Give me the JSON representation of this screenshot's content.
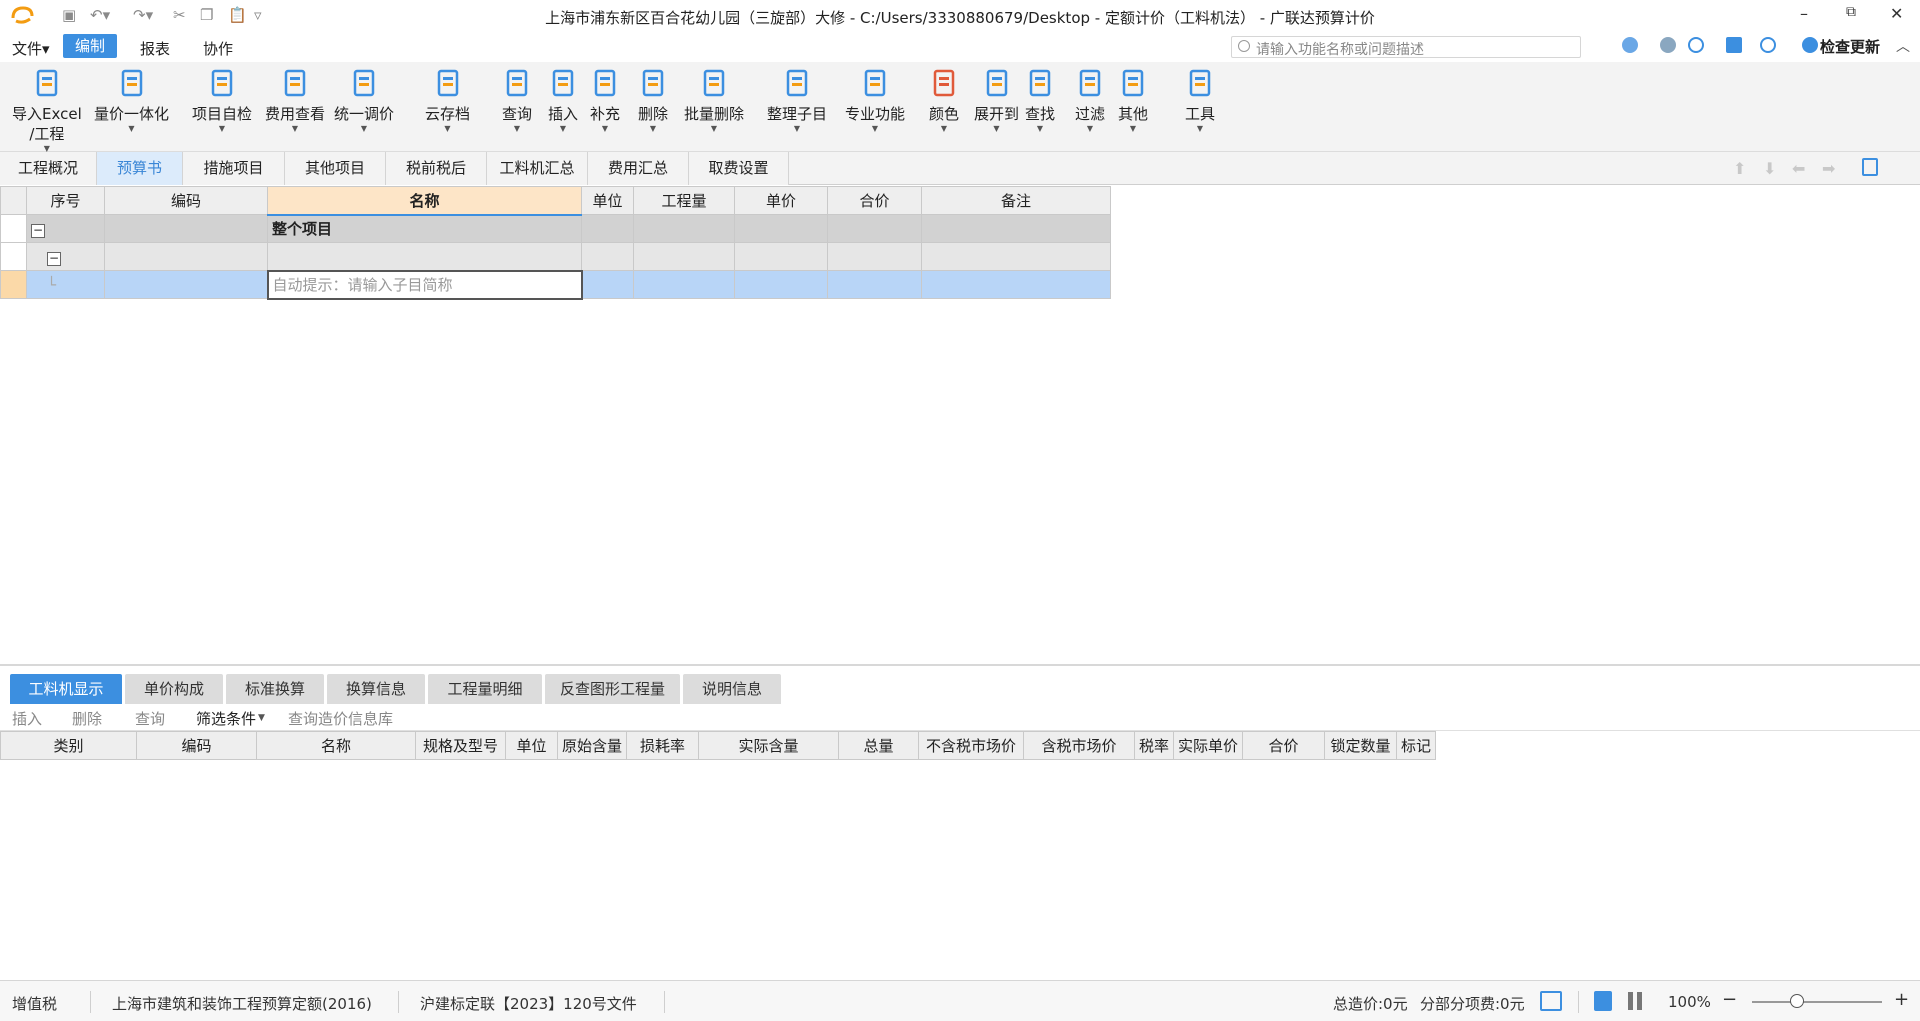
{
  "window": {
    "title": "上海市浦东新区百合花幼儿园（三旋部）大修 - C:/Users/3330880679/Desktop - 定额计价（工料机法） - 广联达预算计价",
    "min": "–",
    "restore": "⧉",
    "close": "✕"
  },
  "menu": {
    "file": "文件▾",
    "edit": "编制",
    "report": "报表",
    "collab": "协作",
    "search_placeholder": "请输入功能名称或问题描述",
    "check_update": "检查更新"
  },
  "ribbon": [
    {
      "l1": "导入Excel",
      "l2": "/工程",
      "icon": "excel-import-icon"
    },
    {
      "l1": "量价一体化",
      "icon": "qty-price-icon"
    },
    {
      "l1": "项目自检",
      "icon": "self-check-icon"
    },
    {
      "l1": "费用查看",
      "icon": "fee-view-icon"
    },
    {
      "l1": "统一调价",
      "icon": "adjust-price-icon"
    },
    {
      "l1": "云存档",
      "icon": "cloud-save-icon"
    },
    {
      "l1": "查询",
      "icon": "query-icon"
    },
    {
      "l1": "插入",
      "icon": "insert-icon"
    },
    {
      "l1": "补充",
      "icon": "supplement-icon"
    },
    {
      "l1": "删除",
      "icon": "delete-icon"
    },
    {
      "l1": "批量删除",
      "icon": "batch-delete-icon"
    },
    {
      "l1": "整理子目",
      "icon": "organize-icon"
    },
    {
      "l1": "专业功能",
      "icon": "pro-function-icon"
    },
    {
      "l1": "颜色",
      "icon": "color-icon"
    },
    {
      "l1": "展开到",
      "icon": "expand-icon"
    },
    {
      "l1": "查找",
      "icon": "find-icon"
    },
    {
      "l1": "过滤",
      "icon": "filter-icon"
    },
    {
      "l1": "其他",
      "icon": "other-icon"
    },
    {
      "l1": "工具",
      "icon": "tools-icon"
    }
  ],
  "tabs": [
    "工程概况",
    "预算书",
    "措施项目",
    "其他项目",
    "税前税后",
    "工料机汇总",
    "费用汇总",
    "取费设置"
  ],
  "main_table": {
    "headers": [
      "序号",
      "编码",
      "名称",
      "单位",
      "工程量",
      "单价",
      "合价",
      "备注"
    ],
    "project_row": "整个项目",
    "input_placeholder": "自动提示：请输入子目简称"
  },
  "bottom_tabs": [
    "工料机显示",
    "单价构成",
    "标准换算",
    "换算信息",
    "工程量明细",
    "反查图形工程量",
    "说明信息"
  ],
  "bottom_toolbar": [
    "插入",
    "删除",
    "查询",
    "筛选条件",
    "查询造价信息库"
  ],
  "bottom_table": {
    "headers": [
      "类别",
      "编码",
      "名称",
      "规格及型号",
      "单位",
      "原始含量",
      "损耗率",
      "实际含量",
      "总量",
      "不含税市场价",
      "含税市场价",
      "税率",
      "实际单价",
      "合价",
      "锁定数量",
      "标记"
    ]
  },
  "status": {
    "tax": "增值税",
    "quota": "上海市建筑和装饰工程预算定额(2016)",
    "doc": "沪建标定联【2023】120号文件",
    "total": "总造价:0元",
    "partial": "分部分项费:0元",
    "zoom": "100%"
  },
  "colors": {
    "accent": "#3c8fe0",
    "selected_row": "#b8d5f7",
    "header_highlight": "#fde5c7"
  }
}
